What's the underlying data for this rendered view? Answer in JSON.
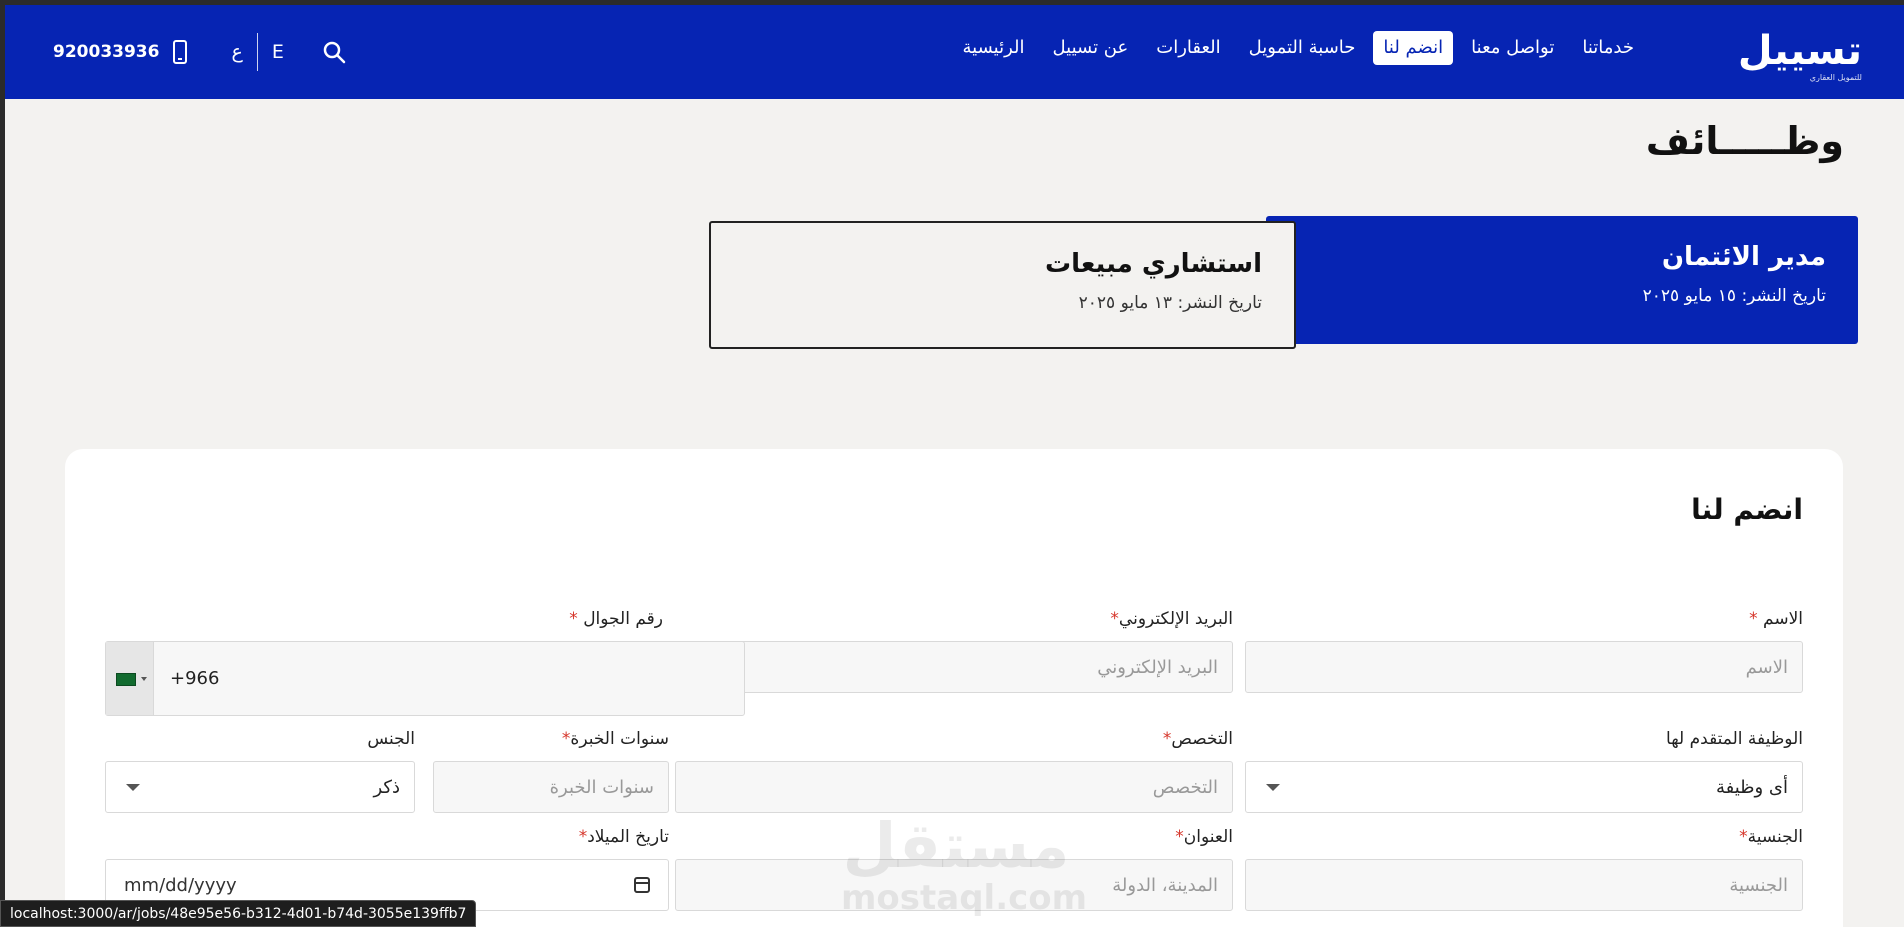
{
  "header": {
    "logo_text": "تسييل",
    "logo_sub": "للتمويل العقاري",
    "nav": [
      {
        "label": "الرئيسية",
        "active": false
      },
      {
        "label": "عن تسييل",
        "active": false
      },
      {
        "label": "العقارات",
        "active": false
      },
      {
        "label": "حاسبة التمويل",
        "active": false
      },
      {
        "label": "انضم لنا",
        "active": true
      },
      {
        "label": "تواصل معنا",
        "active": false
      },
      {
        "label": "خدماتنا",
        "active": false
      }
    ],
    "lang_en": "E",
    "lang_ar": "ع",
    "phone": "920033936",
    "icons": {
      "search": "search-icon",
      "phone": "mobile-phone-icon"
    }
  },
  "page_title": "وظـــــائف",
  "jobs": [
    {
      "title": "مدير الائتمان",
      "date": "تاريخ النشر: ١٥ مايو ٢٠٢٥",
      "active": true
    },
    {
      "title": "استشاري مبيعات",
      "date": "تاريخ النشر: ١٣ مايو ٢٠٢٥",
      "active": false
    }
  ],
  "form": {
    "title": "انضم لنا",
    "name": {
      "label": "الاسم",
      "placeholder": "الاسم"
    },
    "email": {
      "label": "البريد الإلكتروني",
      "placeholder": "البريد الإلكتروني"
    },
    "mobile": {
      "label": "رقم الجوال",
      "code": "+966"
    },
    "job": {
      "label": "الوظيفة المتقدم لها",
      "value": "أى وظيفة"
    },
    "specialty": {
      "label": "التخصص",
      "placeholder": "التخصص"
    },
    "experience": {
      "label": "سنوات الخبرة",
      "placeholder": "سنوات الخبرة"
    },
    "gender": {
      "label": "الجنس",
      "value": "ذكر"
    },
    "nationality": {
      "label": "الجنسية",
      "placeholder": "الجنسية"
    },
    "address": {
      "label": "العنوان",
      "placeholder": "المدينة، الدولة"
    },
    "birthdate": {
      "label": "تاريخ الميلاد",
      "value": "mm/dd/yyyy"
    }
  },
  "watermark": {
    "ar": "مستقل",
    "en": "mostaql.com"
  },
  "status_url": "localhost:3000/ar/jobs/48e95e56-b312-4d01-b74d-3055e139ffb7",
  "colors": {
    "brand": "#0624b3",
    "required": "#d6352a"
  }
}
